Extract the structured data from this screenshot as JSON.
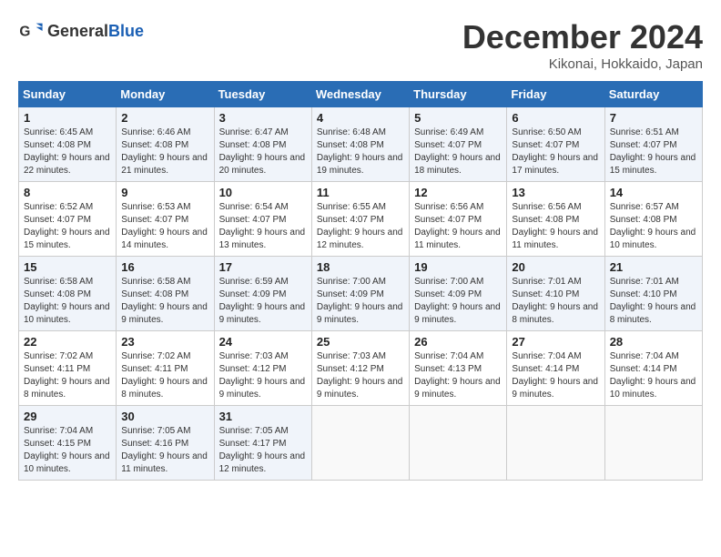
{
  "logo": {
    "general": "General",
    "blue": "Blue"
  },
  "header": {
    "month": "December 2024",
    "location": "Kikonai, Hokkaido, Japan"
  },
  "days_of_week": [
    "Sunday",
    "Monday",
    "Tuesday",
    "Wednesday",
    "Thursday",
    "Friday",
    "Saturday"
  ],
  "weeks": [
    [
      {
        "day": "1",
        "sunrise": "6:45 AM",
        "sunset": "4:08 PM",
        "daylight": "9 hours and 22 minutes."
      },
      {
        "day": "2",
        "sunrise": "6:46 AM",
        "sunset": "4:08 PM",
        "daylight": "9 hours and 21 minutes."
      },
      {
        "day": "3",
        "sunrise": "6:47 AM",
        "sunset": "4:08 PM",
        "daylight": "9 hours and 20 minutes."
      },
      {
        "day": "4",
        "sunrise": "6:48 AM",
        "sunset": "4:08 PM",
        "daylight": "9 hours and 19 minutes."
      },
      {
        "day": "5",
        "sunrise": "6:49 AM",
        "sunset": "4:07 PM",
        "daylight": "9 hours and 18 minutes."
      },
      {
        "day": "6",
        "sunrise": "6:50 AM",
        "sunset": "4:07 PM",
        "daylight": "9 hours and 17 minutes."
      },
      {
        "day": "7",
        "sunrise": "6:51 AM",
        "sunset": "4:07 PM",
        "daylight": "9 hours and 15 minutes."
      }
    ],
    [
      {
        "day": "8",
        "sunrise": "6:52 AM",
        "sunset": "4:07 PM",
        "daylight": "9 hours and 15 minutes."
      },
      {
        "day": "9",
        "sunrise": "6:53 AM",
        "sunset": "4:07 PM",
        "daylight": "9 hours and 14 minutes."
      },
      {
        "day": "10",
        "sunrise": "6:54 AM",
        "sunset": "4:07 PM",
        "daylight": "9 hours and 13 minutes."
      },
      {
        "day": "11",
        "sunrise": "6:55 AM",
        "sunset": "4:07 PM",
        "daylight": "9 hours and 12 minutes."
      },
      {
        "day": "12",
        "sunrise": "6:56 AM",
        "sunset": "4:07 PM",
        "daylight": "9 hours and 11 minutes."
      },
      {
        "day": "13",
        "sunrise": "6:56 AM",
        "sunset": "4:08 PM",
        "daylight": "9 hours and 11 minutes."
      },
      {
        "day": "14",
        "sunrise": "6:57 AM",
        "sunset": "4:08 PM",
        "daylight": "9 hours and 10 minutes."
      }
    ],
    [
      {
        "day": "15",
        "sunrise": "6:58 AM",
        "sunset": "4:08 PM",
        "daylight": "9 hours and 10 minutes."
      },
      {
        "day": "16",
        "sunrise": "6:58 AM",
        "sunset": "4:08 PM",
        "daylight": "9 hours and 9 minutes."
      },
      {
        "day": "17",
        "sunrise": "6:59 AM",
        "sunset": "4:09 PM",
        "daylight": "9 hours and 9 minutes."
      },
      {
        "day": "18",
        "sunrise": "7:00 AM",
        "sunset": "4:09 PM",
        "daylight": "9 hours and 9 minutes."
      },
      {
        "day": "19",
        "sunrise": "7:00 AM",
        "sunset": "4:09 PM",
        "daylight": "9 hours and 9 minutes."
      },
      {
        "day": "20",
        "sunrise": "7:01 AM",
        "sunset": "4:10 PM",
        "daylight": "9 hours and 8 minutes."
      },
      {
        "day": "21",
        "sunrise": "7:01 AM",
        "sunset": "4:10 PM",
        "daylight": "9 hours and 8 minutes."
      }
    ],
    [
      {
        "day": "22",
        "sunrise": "7:02 AM",
        "sunset": "4:11 PM",
        "daylight": "9 hours and 8 minutes."
      },
      {
        "day": "23",
        "sunrise": "7:02 AM",
        "sunset": "4:11 PM",
        "daylight": "9 hours and 8 minutes."
      },
      {
        "day": "24",
        "sunrise": "7:03 AM",
        "sunset": "4:12 PM",
        "daylight": "9 hours and 9 minutes."
      },
      {
        "day": "25",
        "sunrise": "7:03 AM",
        "sunset": "4:12 PM",
        "daylight": "9 hours and 9 minutes."
      },
      {
        "day": "26",
        "sunrise": "7:04 AM",
        "sunset": "4:13 PM",
        "daylight": "9 hours and 9 minutes."
      },
      {
        "day": "27",
        "sunrise": "7:04 AM",
        "sunset": "4:14 PM",
        "daylight": "9 hours and 9 minutes."
      },
      {
        "day": "28",
        "sunrise": "7:04 AM",
        "sunset": "4:14 PM",
        "daylight": "9 hours and 10 minutes."
      }
    ],
    [
      {
        "day": "29",
        "sunrise": "7:04 AM",
        "sunset": "4:15 PM",
        "daylight": "9 hours and 10 minutes."
      },
      {
        "day": "30",
        "sunrise": "7:05 AM",
        "sunset": "4:16 PM",
        "daylight": "9 hours and 11 minutes."
      },
      {
        "day": "31",
        "sunrise": "7:05 AM",
        "sunset": "4:17 PM",
        "daylight": "9 hours and 12 minutes."
      },
      null,
      null,
      null,
      null
    ]
  ]
}
